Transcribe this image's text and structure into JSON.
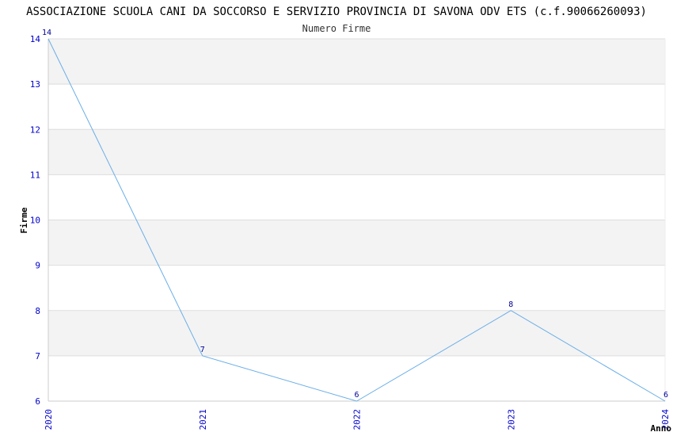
{
  "chart_data": {
    "type": "line",
    "title": "ASSOCIAZIONE SCUOLA CANI DA SOCCORSO E SERVIZIO PROVINCIA DI SAVONA ODV ETS (c.f.90066260093)",
    "subtitle": "Numero Firme",
    "xlabel": "Anno",
    "ylabel": "Firme",
    "x": [
      "2020",
      "2021",
      "2022",
      "2023",
      "2024"
    ],
    "series": [
      {
        "values": [
          14,
          7,
          6,
          8,
          6
        ]
      }
    ],
    "ylim": [
      6,
      14
    ],
    "yticks": [
      6,
      7,
      8,
      9,
      10,
      11,
      12,
      13,
      14
    ],
    "grid": true,
    "colors": {
      "line": "#6aaee8",
      "tick_text": "#0000cc",
      "band": "#f3f3f3",
      "gridline": "#dddddd"
    }
  }
}
